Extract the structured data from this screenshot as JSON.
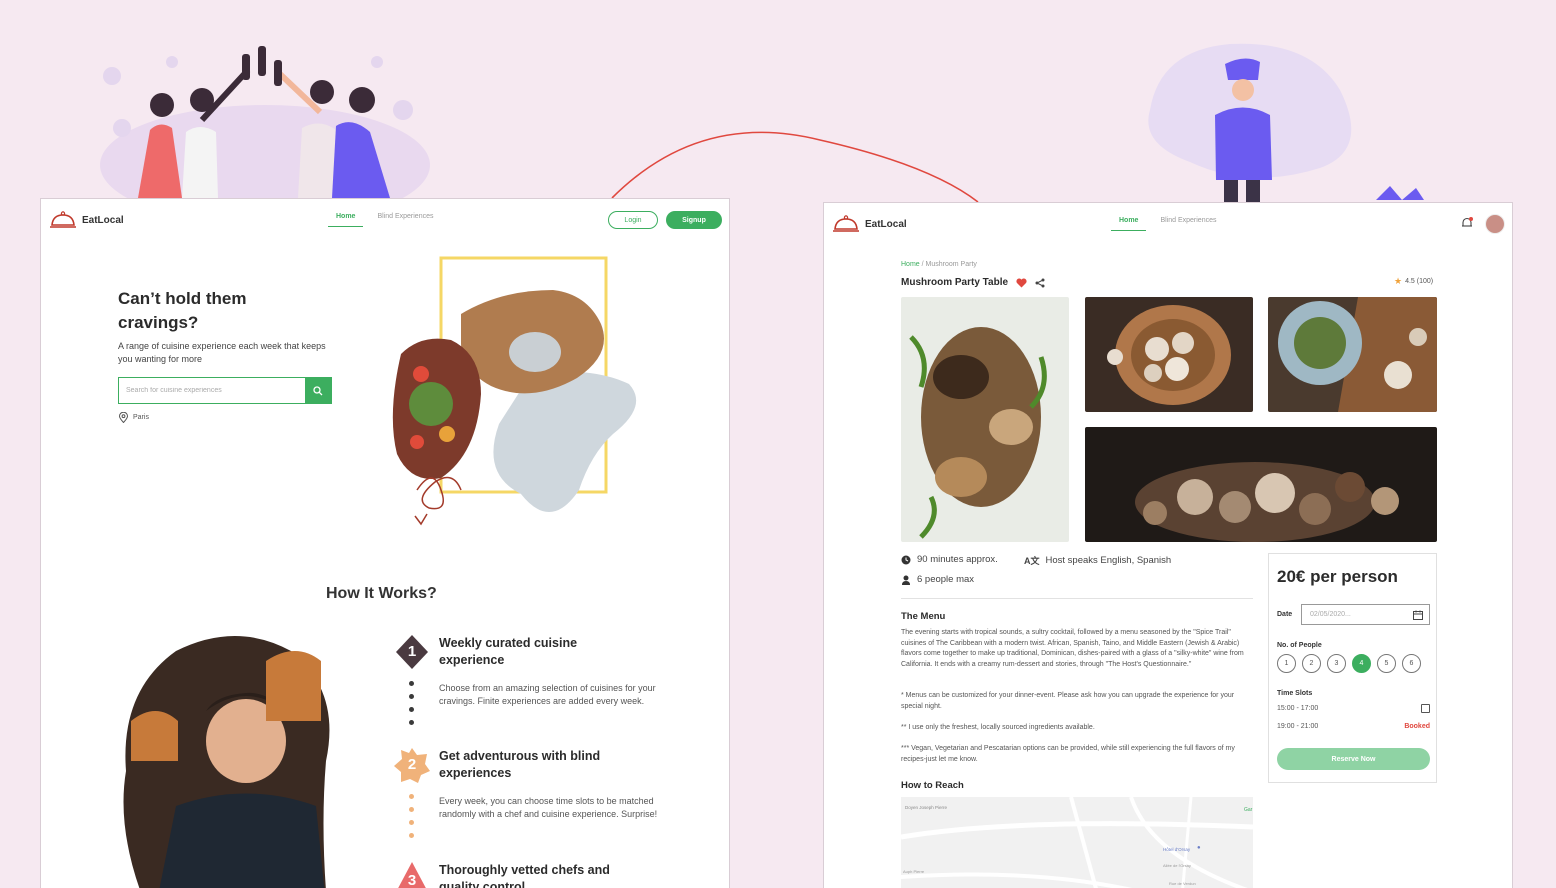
{
  "left": {
    "brand": "EatLocal",
    "nav": {
      "home": "Home",
      "blind": "Blind Experiences"
    },
    "login": "Login",
    "signup": "Signup",
    "hero_title": "Can’t hold them cravings?",
    "hero_sub": "A range of cuisine experience each week that keeps you wanting for more",
    "search_placeholder": "Search for cuisine experiences",
    "location": "Paris",
    "how_title": "How It Works?",
    "steps": [
      {
        "num": "1",
        "title": "Weekly curated cuisine experience",
        "desc": "Choose from an amazing selection of cuisines for your cravings. Finite experiences are added every week."
      },
      {
        "num": "2",
        "title": "Get adventurous with blind experiences",
        "desc": "Every week, you can choose time slots to be matched randomly with a chef and cuisine experience. Surprise!"
      },
      {
        "num": "3",
        "title": "Thoroughly vetted chefs and quality control",
        "desc": ""
      }
    ]
  },
  "right": {
    "brand": "EatLocal",
    "nav": {
      "home": "Home",
      "blind": "Blind Experiences"
    },
    "crumb_home": "Home",
    "crumb_sep": "/",
    "crumb_current": "Mushroom Party",
    "title": "Mushroom Party Table",
    "rating": "4.5 (100)",
    "duration": "90 minutes approx.",
    "languages": "Host speaks English, Spanish",
    "capacity": "6 people max",
    "menu_title": "The Menu",
    "menu_p1": "The evening starts with tropical sounds, a sultry cocktail, followed by a menu seasoned by the \"Spice Trail\" cuisines of The Caribbean with a modern twist. African, Spanish, Taino, and Middle Eastern (Jewish & Arabic) flavors come together to make up traditional, Dominican, dishes-paired with a glass of a \"silky-white\" wine from California. It ends with a creamy rum-dessert and stories, through \"The Host's Questionnaire.\"",
    "menu_p2": "* Menus can be customized for your dinner-event. Please ask how you can upgrade the experience for your special night.",
    "menu_p3": "** I use only the freshest, locally sourced ingredients available.",
    "menu_p4": "*** Vegan, Vegetarian and Pescatarian options can be provided, while still experiencing the full flavors of my recipes-just let me know.",
    "reach_title": "How to Reach",
    "map_labels": [
      "Doyen Joseph Pierre",
      "Hôtel d'Orsay",
      "Gar",
      "Allée de l'Orsay",
      "Rue de Verdun",
      "Auph Pierre"
    ],
    "price": "20€ per person",
    "date_label": "Date",
    "date_value": "02/05/2020...",
    "people_label": "No. of People",
    "people": [
      "1",
      "2",
      "3",
      "4",
      "5",
      "6"
    ],
    "people_selected": "4",
    "slots_label": "Time Slots",
    "slots": [
      {
        "time": "15:00 - 17:00",
        "status": ""
      },
      {
        "time": "19:00 - 21:00",
        "status": "Booked"
      }
    ],
    "reserve": "Reserve Now"
  },
  "colors": {
    "accent": "#3cae5f",
    "danger": "#e0483f",
    "background": "#f6e9f1",
    "illustration": "#6b5bf0"
  }
}
